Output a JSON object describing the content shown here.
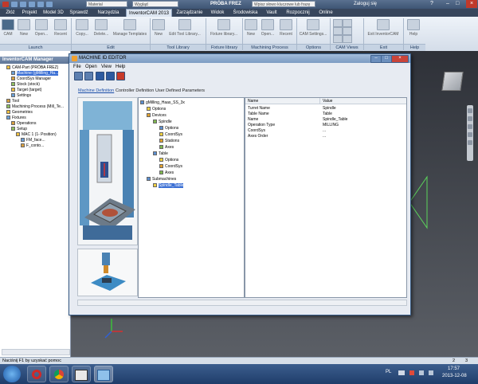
{
  "titlebar": {
    "combo1": "Material",
    "combo2": "Wygląd",
    "app_title": "PRÓBA FREZ",
    "search_placeholder": "Wpisz słowo kluczowe lub frazę",
    "sign_in": "Zaloguj się"
  },
  "ribbon_tabs": [
    "Złóż",
    "Projekt",
    "Model 3D",
    "Sprawdź",
    "Narzędzia",
    "InventorCAM 2013",
    "Zarządzanie",
    "Widok",
    "Środowiska",
    "Vault",
    "Rozpocznij",
    "Online"
  ],
  "ribbon": {
    "buttons": [
      "CAM",
      "New",
      "Open...",
      "Recent",
      "Copy...",
      "Delete...",
      "Manage Templates",
      "New",
      "Edit Tool Library...",
      "Fixture library...",
      "New",
      "Open...",
      "Recent",
      "CAM Settings...",
      "Exit InventorCAM",
      "Help"
    ],
    "groups": [
      "Launch",
      "Edit",
      "Tool Library",
      "Fixture library",
      "Machining Process",
      "Options",
      "CAM Views",
      "Exit",
      "Help"
    ]
  },
  "manager": {
    "title": "InventorCAM Manager",
    "nodes": [
      {
        "label": "CAM-Part (PRÓBA FREZ)",
        "indent": 1
      },
      {
        "label": "Machine (gMilling_Ha...",
        "indent": 2,
        "selected": true
      },
      {
        "label": "CoordSys Manager",
        "indent": 2
      },
      {
        "label": "Stock (stock)",
        "indent": 2
      },
      {
        "label": "Target (target)",
        "indent": 2
      },
      {
        "label": "Settings",
        "indent": 2
      },
      {
        "label": "Tool",
        "indent": 1
      },
      {
        "label": "Machining Process (Mill_Te...",
        "indent": 1
      },
      {
        "label": "Geometries",
        "indent": 1
      },
      {
        "label": "Fixtures",
        "indent": 1
      },
      {
        "label": "Operations",
        "indent": 2
      },
      {
        "label": "Setup",
        "indent": 2
      },
      {
        "label": "MAC 1 (1- Position)",
        "indent": 3
      },
      {
        "label": "FM_face...",
        "indent": 4
      },
      {
        "label": "F_conto...",
        "indent": 4
      }
    ]
  },
  "dialog": {
    "title": "MACHINE ID EDITOR",
    "menu": [
      "File",
      "Open",
      "View",
      "Help"
    ],
    "tabs": [
      "Machine Definition",
      "Controller Definition",
      "User Defined Parameters"
    ],
    "tree": [
      {
        "label": "gMilling_Haas_SS_3x",
        "indent": 0
      },
      {
        "label": "Options",
        "indent": 1
      },
      {
        "label": "Devices",
        "indent": 1
      },
      {
        "label": "Spindle",
        "indent": 2
      },
      {
        "label": "Options",
        "indent": 3
      },
      {
        "label": "CoordSys",
        "indent": 3
      },
      {
        "label": "Stations",
        "indent": 3
      },
      {
        "label": "Axes",
        "indent": 3
      },
      {
        "label": "Table",
        "indent": 2
      },
      {
        "label": "Options",
        "indent": 3
      },
      {
        "label": "CoordSys",
        "indent": 3
      },
      {
        "label": "Axes",
        "indent": 3
      },
      {
        "label": "Submachines",
        "indent": 1
      },
      {
        "label": "Spindle_Table",
        "indent": 2,
        "selected": true
      }
    ],
    "props": {
      "col_name": "Name",
      "col_value": "Value",
      "rows": [
        [
          "Turret Name",
          "Spindle"
        ],
        [
          "Table Name",
          "Table"
        ],
        [
          "Name",
          "Spindle_Table"
        ],
        [
          "Operation Type",
          "MILLING"
        ],
        [
          "CoordSys",
          "..."
        ],
        [
          "Axes Order",
          "..."
        ]
      ]
    }
  },
  "statusbar": {
    "text": "Naciśnij F1 by uzyskać pomoc",
    "num1": "2",
    "num2": "3"
  },
  "taskbar": {
    "lang": "PL",
    "time": "17:57",
    "date": "2013-12-08"
  }
}
